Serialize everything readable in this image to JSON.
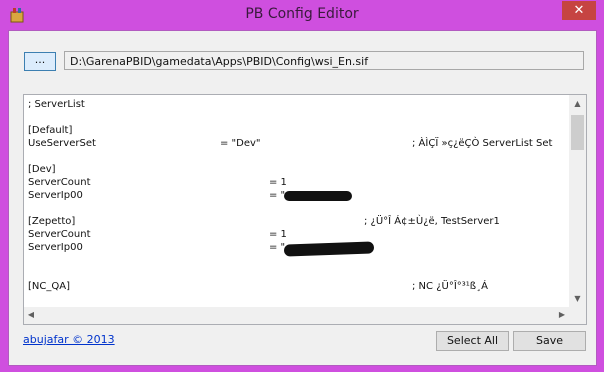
{
  "window": {
    "title": "PB Config Editor",
    "close_label": "✕"
  },
  "toolbar": {
    "browse_label": "...",
    "path": "D:\\GarenaPBID\\gamedata\\Apps\\PBID\\Config\\wsi_En.sif"
  },
  "editor": {
    "lines": [
      {
        "c1": "; ServerList"
      },
      {},
      {
        "c1": "[Default]"
      },
      {
        "c1": "UseServerSet",
        "c2": "= \"Dev\"",
        "c3": "; ÀÌÇÏ »ç¿ëÇÒ ServerList Set"
      },
      {},
      {
        "c1": "[Dev]"
      },
      {
        "c1": "ServerCount",
        "c2": "= 1"
      },
      {
        "c1": "ServerIp00",
        "c2": "= \""
      },
      {},
      {
        "c1": "[Zepetto]",
        "c3": "; ¿Ü°Î Á¢±Ù¿ë, TestServer1"
      },
      {
        "c1": "ServerCount",
        "c2": "= 1"
      },
      {
        "c1": "ServerIp00",
        "c2": "= \""
      },
      {},
      {},
      {
        "c1": "[NC_QA]",
        "c3": "; NC ¿Ü°Î°³¹ß¸Á"
      }
    ]
  },
  "footer": {
    "credit_link": "abujafar © 2013",
    "select_all_label": "Select All",
    "save_label": "Save"
  }
}
